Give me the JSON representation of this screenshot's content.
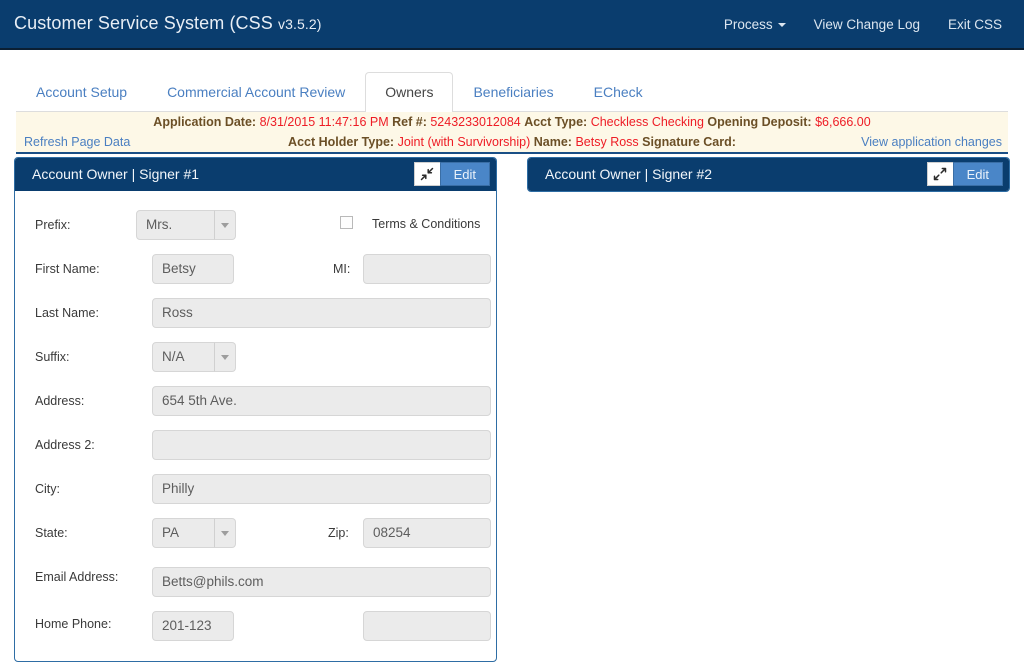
{
  "navbar": {
    "brand_text": "Customer Service System (CSS ",
    "brand_version": "v3.5.2)",
    "links": [
      {
        "label": "Process",
        "icon": "caret-down-icon",
        "has_caret": true
      },
      {
        "label": "View Change Log",
        "has_caret": false
      },
      {
        "label": "Exit CSS",
        "has_caret": false
      }
    ],
    "background": "#0a3d6e"
  },
  "tabs": [
    {
      "label": "Account Setup",
      "active": false
    },
    {
      "label": "Commercial Account Review",
      "active": false
    },
    {
      "label": "Owners",
      "active": true
    },
    {
      "label": "Beneficiaries",
      "active": false
    },
    {
      "label": "ECheck",
      "active": false
    }
  ],
  "banner": {
    "background": "#fdf8e7",
    "value_color": "#ee1c25",
    "refresh_link": "Refresh Page Data",
    "changes_link": "View application changes",
    "row1": [
      {
        "label": "Application Date",
        "value": "8/31/2015 11:47:16 PM"
      },
      {
        "label": "Ref #",
        "value": "5243233012084"
      },
      {
        "label": "Acct Type",
        "value": "Checkless Checking"
      },
      {
        "label": "Opening Deposit",
        "value": "$6,666.00"
      }
    ],
    "row2": [
      {
        "label": "Acct Holder Type",
        "value": "Joint (with Survivorship)"
      },
      {
        "label": "Name",
        "value": "Betsy Ross"
      },
      {
        "label": "Signature Card",
        "value": ""
      }
    ]
  },
  "panels": {
    "left": {
      "title": "Account Owner | Signer #1",
      "collapse_icon": "collapse-arrows-icon",
      "edit_label": "Edit",
      "expanded": true
    },
    "right": {
      "title": "Account Owner | Signer #2",
      "expand_icon": "expand-arrows-icon",
      "edit_label": "Edit",
      "expanded": false
    }
  },
  "form": {
    "prefix_label": "Prefix:",
    "prefix_value": "Mrs.",
    "terms_label": "Terms & Conditions",
    "terms_checked": false,
    "first_name_label": "First Name:",
    "first_name_value": "Betsy",
    "mi_label": "MI:",
    "mi_value": "",
    "last_name_label": "Last Name:",
    "last_name_value": "Ross",
    "suffix_label": "Suffix:",
    "suffix_value": "N/A",
    "address_label": "Address:",
    "address_value": "654 5th Ave.",
    "address2_label": "Address 2:",
    "address2_value": "",
    "city_label": "City:",
    "city_value": "Philly",
    "state_label": "State:",
    "state_value": "PA",
    "zip_label": "Zip:",
    "zip_value": "08254",
    "email_label": "Email Address:",
    "email_value": "Betts@phils.com",
    "home_phone_label": "Home Phone:",
    "home_phone_value": "201-123",
    "home_phone_ext_value": ""
  }
}
